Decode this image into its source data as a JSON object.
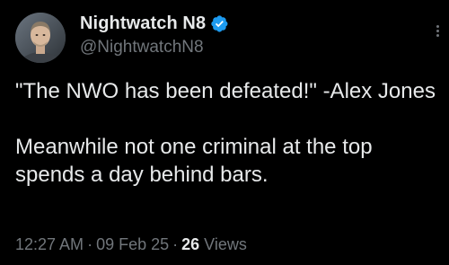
{
  "author": {
    "display_name": "Nightwatch N8",
    "handle": "@NightwatchN8",
    "verified": true,
    "avatar_icon": "profile-photo",
    "verified_icon": "verified-badge-icon",
    "verified_color": "#1d9bf0"
  },
  "tweet": {
    "paragraphs": [
      "\"The NWO has been defeated!\" -Alex Jones",
      "Meanwhile not one criminal at the top spends a day behind bars."
    ],
    "time": "12:27 AM",
    "date": "09 Feb 25",
    "views_count": "26",
    "views_label": "Views",
    "separator": "·"
  },
  "colors": {
    "background": "#000000",
    "text_primary": "#e7e9ea",
    "text_secondary": "#71767b"
  }
}
